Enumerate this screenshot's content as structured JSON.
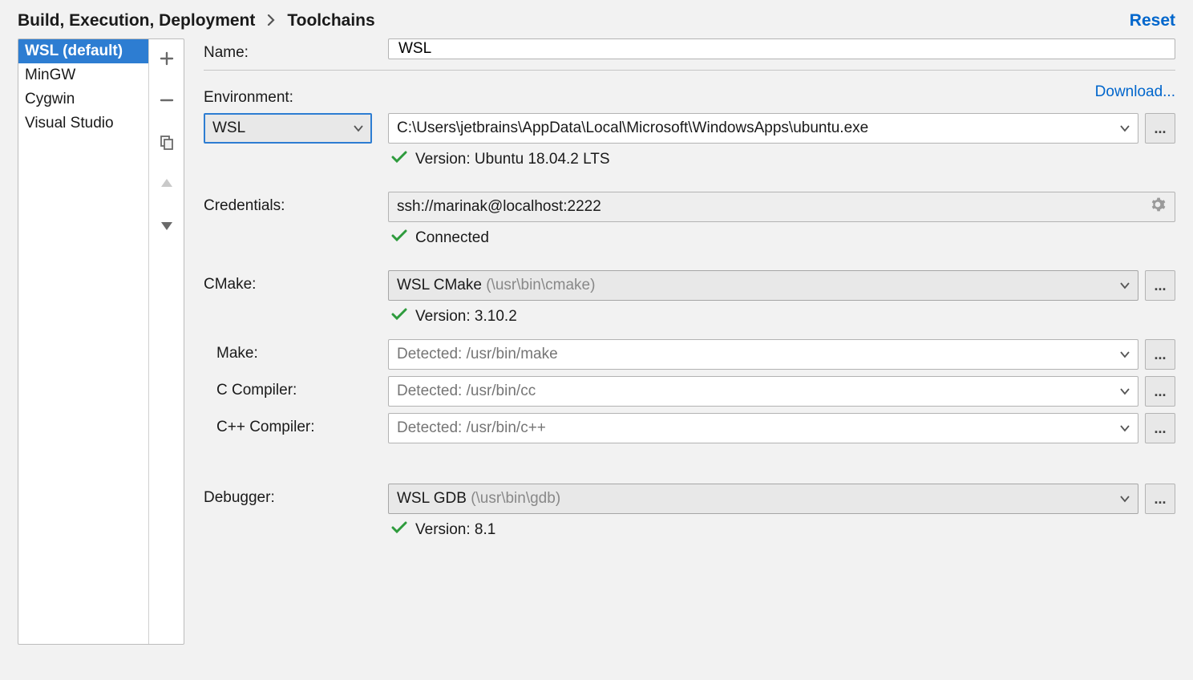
{
  "breadcrumb": {
    "parent": "Build, Execution, Deployment",
    "current": "Toolchains"
  },
  "reset_label": "Reset",
  "sidebar": {
    "items": [
      {
        "label": "WSL (default)",
        "selected": true
      },
      {
        "label": "MinGW",
        "selected": false
      },
      {
        "label": "Cygwin",
        "selected": false
      },
      {
        "label": "Visual Studio",
        "selected": false
      }
    ]
  },
  "form": {
    "name": {
      "label": "Name:",
      "value": "WSL"
    },
    "environment": {
      "label": "Environment:",
      "download_link": "Download...",
      "type_selected": "WSL",
      "path_value": "C:\\Users\\jetbrains\\AppData\\Local\\Microsoft\\WindowsApps\\ubuntu.exe",
      "status": "Version: Ubuntu 18.04.2 LTS"
    },
    "credentials": {
      "label": "Credentials:",
      "value": "ssh://marinak@localhost:2222",
      "status": "Connected"
    },
    "cmake": {
      "label": "CMake:",
      "selected": "WSL CMake",
      "hint": "(\\usr\\bin\\cmake)",
      "status": "Version: 3.10.2"
    },
    "make": {
      "label": "Make:",
      "placeholder": "Detected: /usr/bin/make"
    },
    "ccompiler": {
      "label": "C Compiler:",
      "placeholder": "Detected: /usr/bin/cc"
    },
    "cppcompiler": {
      "label": "C++ Compiler:",
      "placeholder": "Detected: /usr/bin/c++"
    },
    "debugger": {
      "label": "Debugger:",
      "selected": "WSL GDB",
      "hint": "(\\usr\\bin\\gdb)",
      "status": "Version: 8.1"
    }
  },
  "ellipsis": "..."
}
